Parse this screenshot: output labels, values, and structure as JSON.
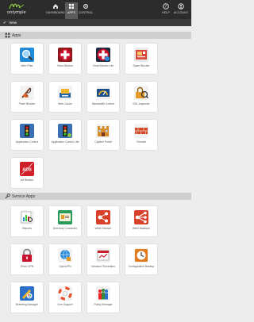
{
  "brand": {
    "name": "ontymple"
  },
  "nav": [
    {
      "id": "dashboard",
      "label": "DASHBOARD",
      "icon": "home-icon"
    },
    {
      "id": "apps",
      "label": "APPS",
      "icon": "apps-grid-icon",
      "active": true
    },
    {
      "id": "control",
      "label": "CONTROL",
      "icon": "settings-icon"
    },
    {
      "id": "help",
      "label": "HELP",
      "icon": "help-icon"
    },
    {
      "id": "account",
      "label": "ACCOUNT",
      "icon": "account-icon"
    }
  ],
  "subbar": {
    "label": "View"
  },
  "sections": {
    "apps": {
      "title": "Apps"
    },
    "service_apps": {
      "title": "Service Apps"
    }
  },
  "apps": [
    {
      "label": "Web Filter",
      "icon": "magnifier-icon",
      "color": "#1f8ad8"
    },
    {
      "label": "Virus Blocker",
      "icon": "medical-cross-icon",
      "color": "#c8102e"
    },
    {
      "label": "Virus Blocker Lite",
      "icon": "medical-cross-icon",
      "color": "#c8102e"
    },
    {
      "label": "Spam Blocker",
      "icon": "postcard-icon",
      "color": "#d9473b"
    },
    {
      "label": "Phish Blocker",
      "icon": "fishing-hook-icon",
      "color": "#c45a2b"
    },
    {
      "label": "Web Cache",
      "icon": "printer-stack-icon",
      "color": "#1f63a8"
    },
    {
      "label": "Bandwidth Control",
      "icon": "gauge-icon",
      "color": "#1c4f8a"
    },
    {
      "label": "SSL Inspector",
      "icon": "lock-scan-icon",
      "color": "#e39b25"
    },
    {
      "label": "Application Control",
      "icon": "traffic-light-icon",
      "color": "#3a6fb3"
    },
    {
      "label": "Application Control Lite",
      "icon": "traffic-light-icon",
      "color": "#3a6fb3"
    },
    {
      "label": "Captive Portal",
      "icon": "castle-icon",
      "color": "#d98c2a"
    },
    {
      "label": "Firewall",
      "icon": "brick-wall-icon",
      "color": "#d24a2a"
    },
    {
      "label": "Ad Blocker",
      "icon": "ads-block-icon",
      "color": "#d11f2a"
    }
  ],
  "service_apps": [
    {
      "label": "Reports",
      "icon": "report-magnifier-icon",
      "color": "#2a8ad8"
    },
    {
      "label": "Directory Connector",
      "icon": "id-card-icon",
      "color": "#2a9a5a"
    },
    {
      "label": "WAN Failover",
      "icon": "network-split-icon",
      "color": "#d8402a"
    },
    {
      "label": "WAN Balancer",
      "icon": "network-tree-icon",
      "color": "#d8402a"
    },
    {
      "label": "IPsec VPN",
      "icon": "padlock-icon",
      "color": "#c8102e"
    },
    {
      "label": "OpenVPN",
      "icon": "globe-lock-icon",
      "color": "#2a8ad8"
    },
    {
      "label": "Intrusion Prevention",
      "icon": "dashboard-alarm-icon",
      "color": "#c81f2a"
    },
    {
      "label": "Configuration Backup",
      "icon": "clock-icon",
      "color": "#e07a1a"
    },
    {
      "label": "Branding Manager",
      "icon": "brush-palette-icon",
      "color": "#2a6fc8"
    },
    {
      "label": "Live Support",
      "icon": "lifebuoy-icon",
      "color": "#e8502a"
    },
    {
      "label": "Policy Manager",
      "icon": "people-group-icon",
      "color": "#3a8a3a"
    }
  ]
}
